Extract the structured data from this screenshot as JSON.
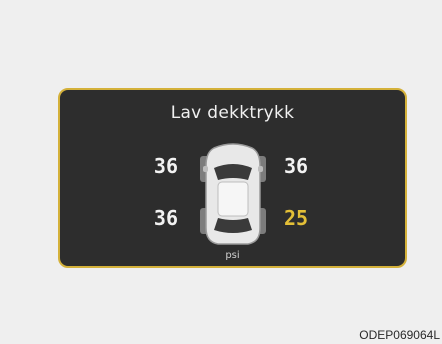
{
  "display": {
    "title": "Lav dekktrykk",
    "unit": "psi",
    "colors": {
      "background": "#2d2d2d",
      "border": "#d4b13a",
      "normal_text": "#f2f2f2",
      "warning_text": "#e3bf37"
    }
  },
  "tires": {
    "front_left": "36",
    "front_right": "36",
    "rear_left": "36",
    "rear_right": "25",
    "low_pressure_tire": "rear_right"
  },
  "footer": {
    "code": "ODEP069064L"
  }
}
